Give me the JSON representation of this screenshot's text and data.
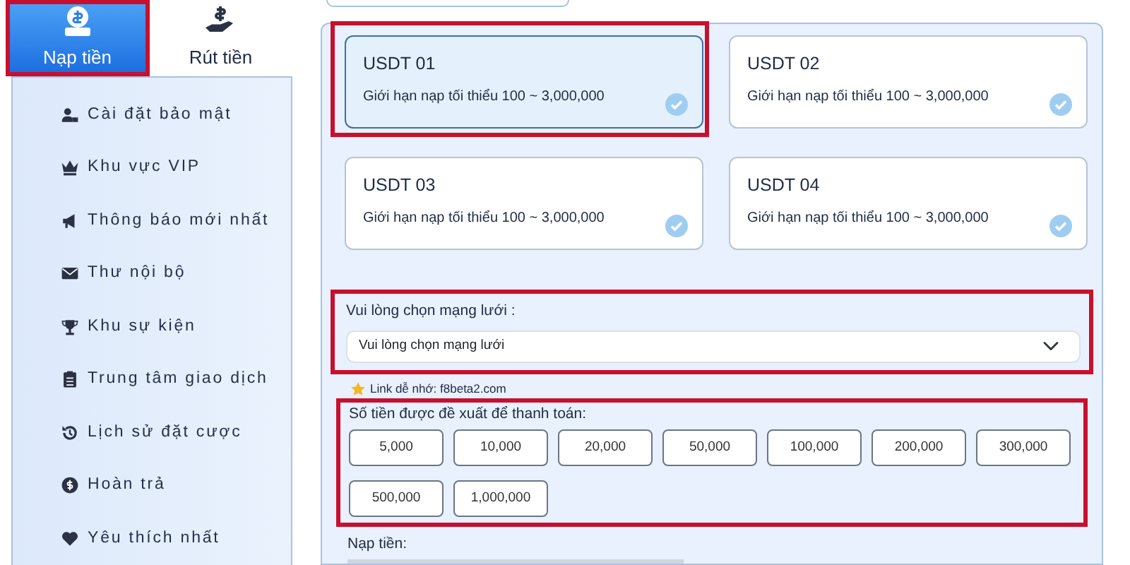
{
  "tabs": [
    {
      "label": "Nạp tiền",
      "selected": true,
      "highlighted": true
    },
    {
      "label": "Rút tiền",
      "selected": false,
      "highlighted": false
    }
  ],
  "menu": [
    {
      "label": "Cài đặt bảo mật"
    },
    {
      "label": "Khu vực VIP"
    },
    {
      "label": "Thông báo mới nhất"
    },
    {
      "label": "Thư nội bộ"
    },
    {
      "label": "Khu sự kiện"
    },
    {
      "label": "Trung tâm giao dịch"
    },
    {
      "label": "Lịch sử đặt cược"
    },
    {
      "label": "Hoàn trả"
    },
    {
      "label": "Yêu thích nhất"
    }
  ],
  "channels": [
    {
      "title": "USDT 01",
      "limit": "Giới hạn nạp tối thiểu 100 ~ 3,000,000",
      "selected": true,
      "highlighted": true
    },
    {
      "title": "USDT 02",
      "limit": "Giới hạn nạp tối thiểu 100 ~ 3,000,000",
      "selected": false,
      "highlighted": false
    },
    {
      "title": "USDT 03",
      "limit": "Giới hạn nạp tối thiểu 100 ~ 3,000,000",
      "selected": false,
      "highlighted": false
    },
    {
      "title": "USDT 04",
      "limit": "Giới hạn nạp tối thiểu 100 ~ 3,000,000",
      "selected": false,
      "highlighted": false
    }
  ],
  "network": {
    "label": "Vui lòng chọn mạng lưới :",
    "value": "Vui lòng chọn mạng lưới",
    "highlighted": true
  },
  "link_note": "Link dễ nhớ: f8beta2.com",
  "amounts": {
    "label": "Số tiền được đề xuất để thanh toán:",
    "highlighted": true,
    "options": [
      "5,000",
      "10,000",
      "20,000",
      "50,000",
      "100,000",
      "200,000",
      "300,000",
      "500,000",
      "1,000,000"
    ]
  },
  "deposit_label": "Nạp tiền:"
}
